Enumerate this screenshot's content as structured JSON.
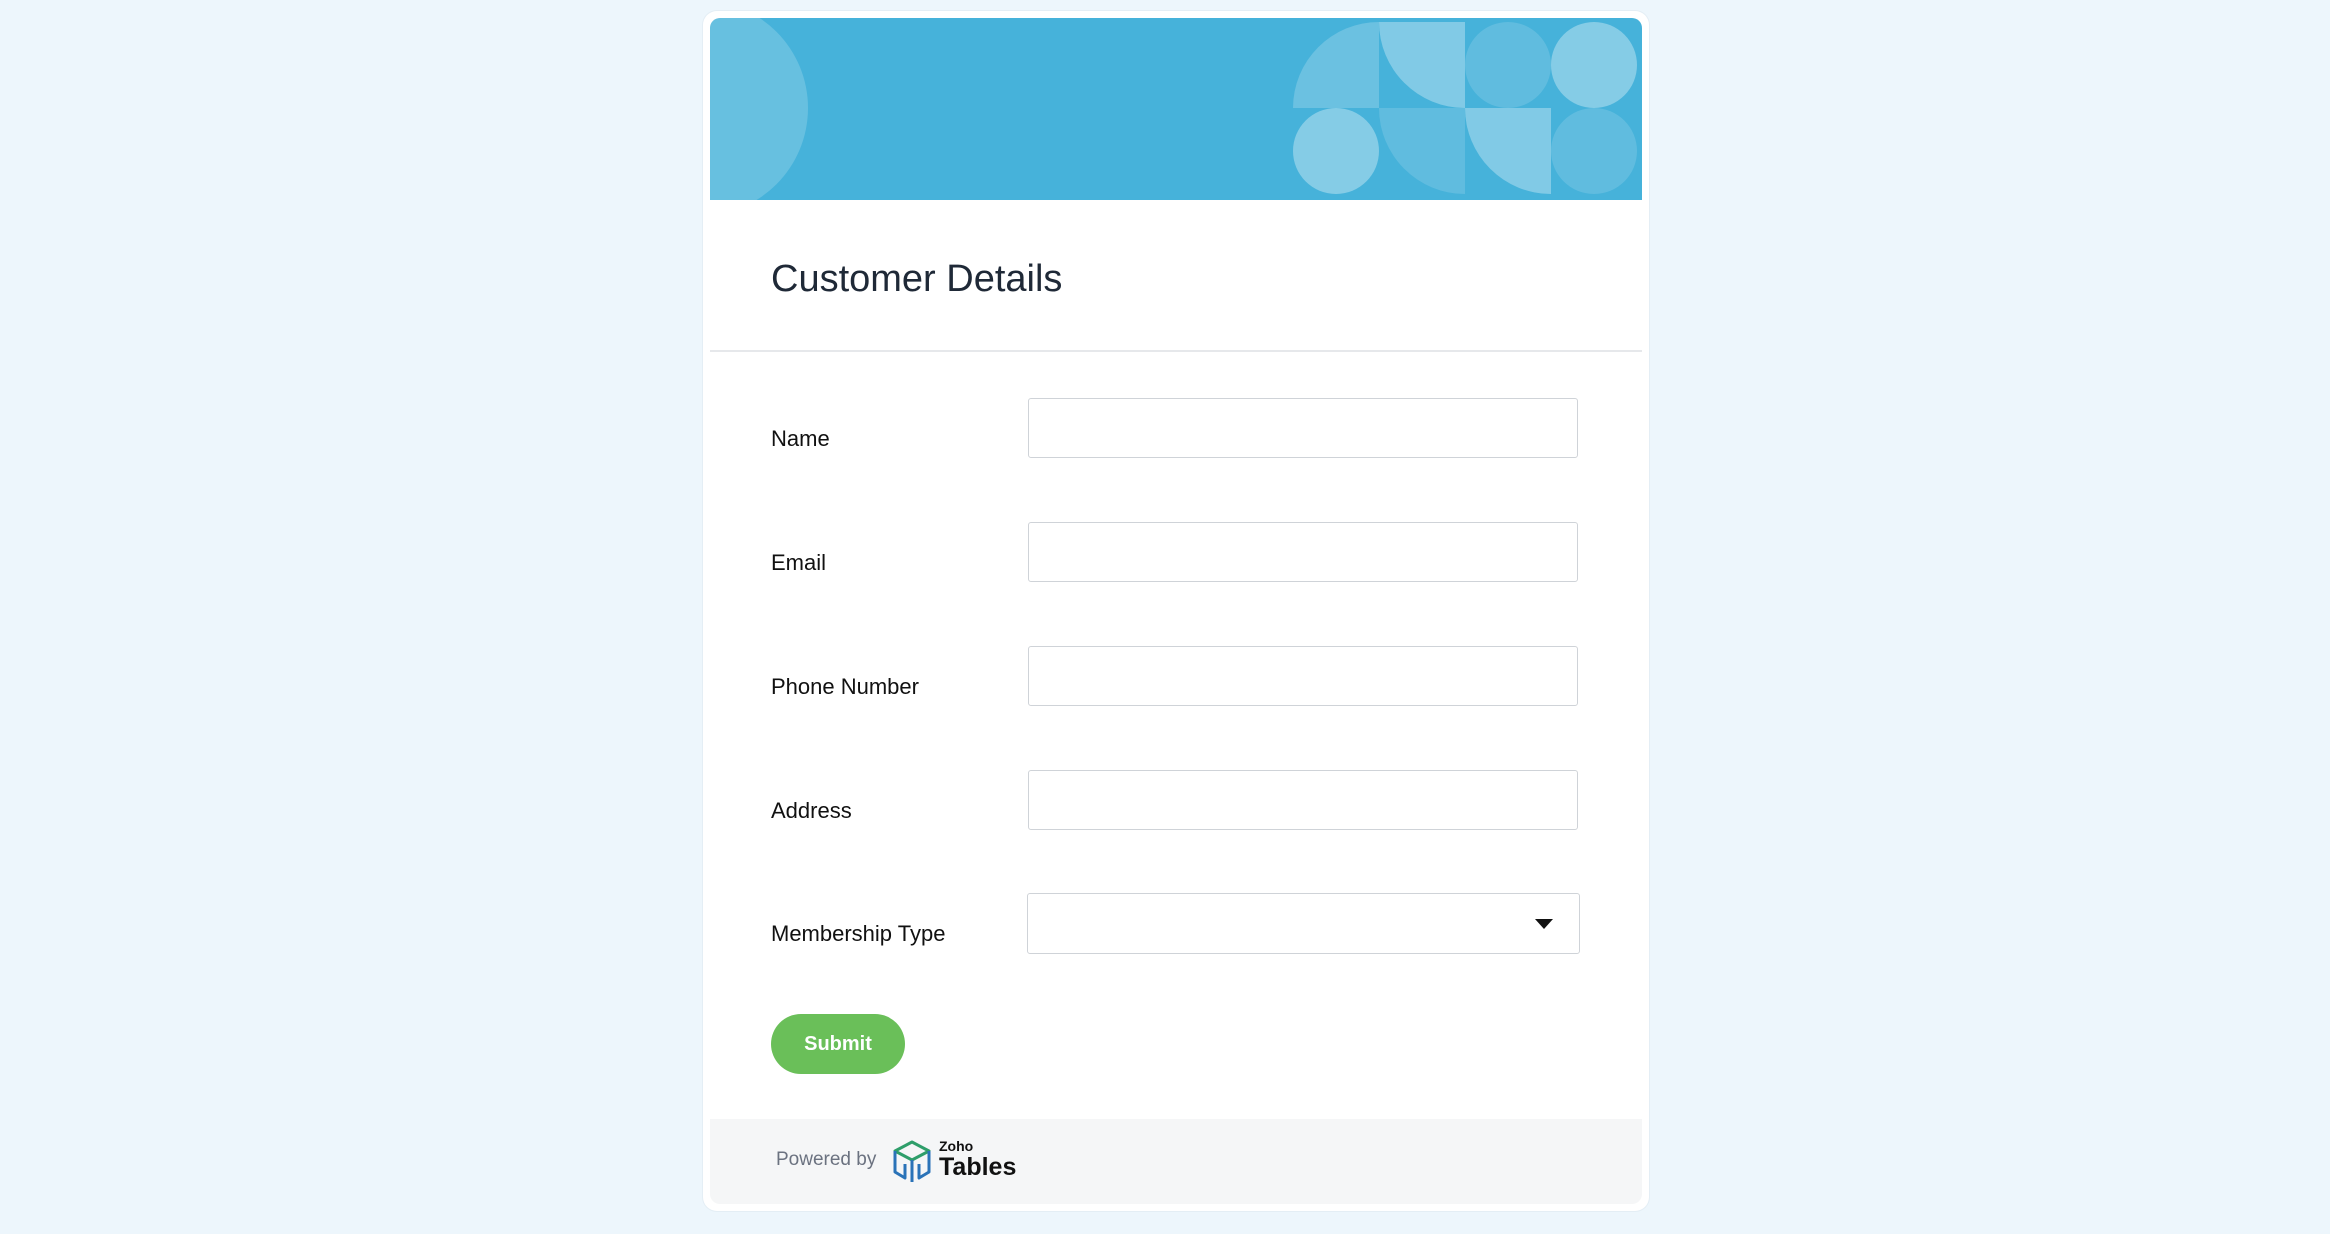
{
  "form": {
    "title": "Customer Details",
    "fields": [
      {
        "label": "Name",
        "value": ""
      },
      {
        "label": "Email",
        "value": ""
      },
      {
        "label": "Phone Number",
        "value": ""
      },
      {
        "label": "Address",
        "value": ""
      },
      {
        "label": "Membership Type",
        "value": ""
      }
    ],
    "submit_label": "Submit"
  },
  "footer": {
    "powered_by": "Powered by",
    "brand_small": "Zoho",
    "brand_big": "Tables"
  },
  "colors": {
    "page_background": "#edf6fc",
    "banner": "#46b2da",
    "submit": "#6abf59"
  }
}
